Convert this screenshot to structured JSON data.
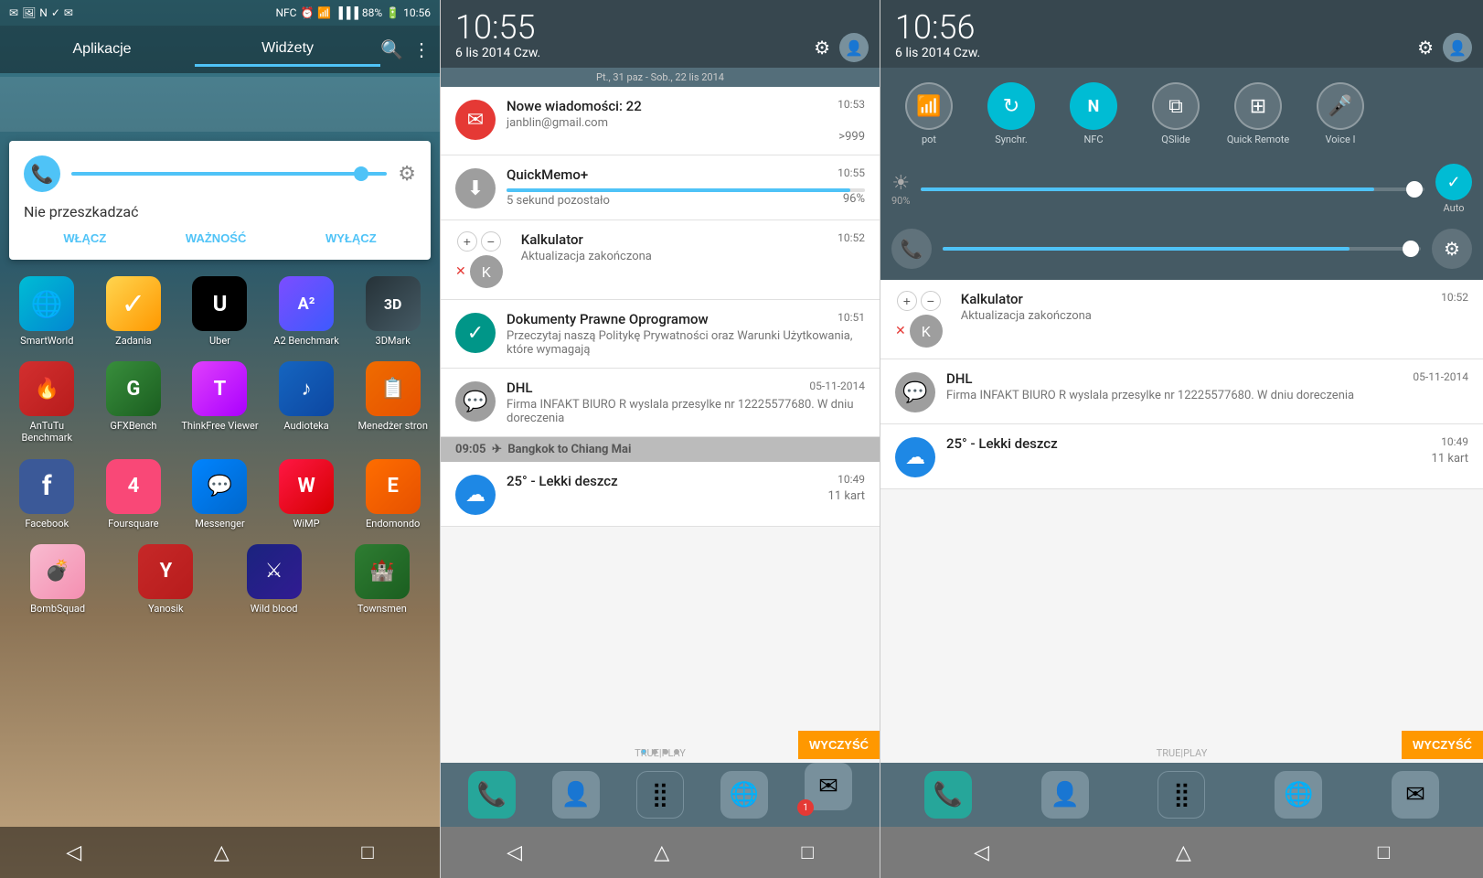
{
  "panel1": {
    "status": {
      "time": "10:56",
      "battery": "88%",
      "signal": "▲▲▲"
    },
    "tabs": {
      "apps_label": "Aplikacje",
      "widgets_label": "Widżety"
    },
    "widget": {
      "title": "Nie przeszkadzać",
      "btn1": "WŁĄCZ",
      "btn2": "WAŻNOŚĆ",
      "btn3": "WYŁĄCZ"
    },
    "apps": [
      {
        "label": "SmartWorld",
        "icon": "🌐",
        "cls": "ic-smartworld"
      },
      {
        "label": "Zadania",
        "icon": "✓",
        "cls": "ic-zadania"
      },
      {
        "label": "Uber",
        "icon": "U",
        "cls": "ic-uber"
      },
      {
        "label": "A2 Benchmark",
        "icon": "A²",
        "cls": "ic-a2bench"
      },
      {
        "label": "3DMark",
        "icon": "3D",
        "cls": "ic-3dmark"
      },
      {
        "label": "AnTuTu Benchmark",
        "icon": "🔥",
        "cls": "ic-antutu"
      },
      {
        "label": "GFXBench",
        "icon": "G",
        "cls": "ic-gfxbench"
      },
      {
        "label": "ThinkFree Viewer",
        "icon": "T",
        "cls": "ic-thinkfree"
      },
      {
        "label": "Audioteka",
        "icon": "♪",
        "cls": "ic-audioteka"
      },
      {
        "label": "Menedżer stron",
        "icon": "📋",
        "cls": "ic-menedzer"
      },
      {
        "label": "Facebook",
        "icon": "f",
        "cls": "ic-facebook"
      },
      {
        "label": "Foursquare",
        "icon": "4",
        "cls": "ic-foursquare"
      },
      {
        "label": "Messenger",
        "icon": "💬",
        "cls": "ic-messenger"
      },
      {
        "label": "WiMP",
        "icon": "W",
        "cls": "ic-wimp"
      },
      {
        "label": "Endomondo",
        "icon": "E",
        "cls": "ic-endomondo"
      },
      {
        "label": "BombSquad",
        "icon": "💣",
        "cls": "ic-bombsquad"
      },
      {
        "label": "Yanosik",
        "icon": "Y",
        "cls": "ic-yanosik"
      },
      {
        "label": "Wild blood",
        "icon": "⚔",
        "cls": "ic-wildblood"
      },
      {
        "label": "Townsmen",
        "icon": "🏰",
        "cls": "ic-townsmen"
      }
    ],
    "nav": {
      "back": "◁",
      "home": "△",
      "recents": "□"
    }
  },
  "panel2": {
    "time": "10:55",
    "date": "6 lis 2014 Czw.",
    "calendar_bar": "Pt., 31 paz - Sob., 22 lis 2014",
    "notifications": [
      {
        "id": "gmail",
        "app": "Nowe wiadomości: 22",
        "sub": "janblin@gmail.com",
        "time": "10:53",
        "count": ">999",
        "avatar_color": "na-red",
        "avatar_icon": "✉"
      },
      {
        "id": "quickmemo",
        "app": "QuickMemo+",
        "sub": "5 sekund pozostało",
        "time": "10:55",
        "progress": 96,
        "progress_label": "96%",
        "avatar_color": "na-gray",
        "avatar_icon": "⬇"
      },
      {
        "id": "kalkulator",
        "app": "Kalkulator",
        "sub": "Aktualizacja zakończona",
        "time": "10:52",
        "avatar_color": "na-gray",
        "avatar_icon": "K"
      },
      {
        "id": "dokumenty",
        "app": "Dokumenty Prawne Oprogramow",
        "sub": "Przeczytaj naszą Politykę Prywatności oraz Warunki Użytkowania, które wymagają",
        "time": "10:51",
        "avatar_color": "na-teal",
        "avatar_icon": "✓"
      },
      {
        "id": "dhl",
        "app": "DHL",
        "sub": "Firma INFAKT BIURO R wyslala przesylke nr 12225577680. W dniu doreczenia",
        "time": "05-11-2014",
        "avatar_color": "na-gray",
        "avatar_icon": "💬"
      },
      {
        "id": "weather",
        "app": "25° - Lekki deszcz",
        "sub": "",
        "time": "10:49",
        "count": "11 kart",
        "avatar_color": "na-blue",
        "avatar_icon": "☁"
      }
    ],
    "wyczysc": "WYCZYŚĆ",
    "trueplay": "TRUE|PLAY",
    "dock": {
      "phone": "📞",
      "contacts": "👤",
      "apps": "⣿",
      "web": "🌐",
      "messages": "✉",
      "badge": "1"
    },
    "nav": {
      "back": "◁",
      "home": "△",
      "recents": "□"
    }
  },
  "panel3": {
    "time": "10:56",
    "date": "6 lis 2014 Czw.",
    "qs_items": [
      {
        "label": "pot",
        "icon": "📶",
        "active": false
      },
      {
        "label": "Synchr.",
        "icon": "↻",
        "active": true
      },
      {
        "label": "NFC",
        "icon": "N",
        "active": true
      },
      {
        "label": "QSlide",
        "icon": "⧉",
        "active": false
      },
      {
        "label": "Quick Remote",
        "icon": "⊞",
        "active": false
      },
      {
        "label": "Voice I",
        "icon": "🎤",
        "active": false
      }
    ],
    "brightness_pct": "90%",
    "brightness_label": "Auto",
    "notifications": [
      {
        "id": "kalkulator",
        "app": "Kalkulator",
        "sub": "Aktualizacja zakończona",
        "time": "10:52",
        "avatar_color": "na-gray",
        "avatar_icon": "K"
      },
      {
        "id": "dhl",
        "app": "DHL",
        "sub": "Firma INFAKT BIURO R wyslala przesylke nr 12225577680. W dniu doreczenia",
        "time": "05-11-2014",
        "avatar_color": "na-gray",
        "avatar_icon": "💬"
      },
      {
        "id": "weather",
        "app": "25° - Lekki deszcz",
        "sub": "",
        "time": "10:49",
        "count": "11 kart",
        "avatar_color": "na-blue",
        "avatar_icon": "☁"
      }
    ],
    "wyczysc": "WYCZYŚĆ",
    "trueplay": "TRUE|PLAY",
    "dock": {
      "phone": "📞",
      "contacts": "👤",
      "apps": "⣿",
      "web": "🌐",
      "messages": "✉"
    },
    "nav": {
      "back": "◁",
      "home": "△",
      "recents": "□"
    }
  }
}
